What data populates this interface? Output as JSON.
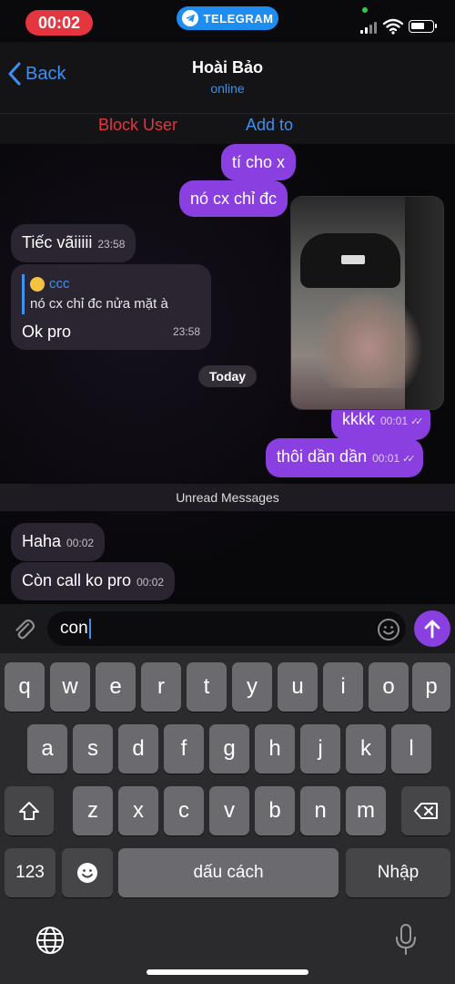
{
  "status_bar": {
    "time": "00:02",
    "app_pill": "TELEGRAM"
  },
  "header": {
    "back_label": "Back",
    "contact_name": "Hoài Bảo",
    "contact_status": "online",
    "block_user_label": "Block User",
    "add_contact_label": "Add to"
  },
  "messages": [
    {
      "direction": "out",
      "text": "tí cho x",
      "partially_hidden": true
    },
    {
      "direction": "out",
      "text": "nó cx chỉ đc",
      "partially_hidden": true
    },
    {
      "direction": "in",
      "text": "Tiếc vãiiiii",
      "time": "23:58"
    },
    {
      "direction": "in",
      "reply_author": "ccc",
      "reply_text": "nó cx chỉ đc nửa mặt à",
      "text": "Ok pro",
      "time": "23:58"
    },
    {
      "direction": "out",
      "text": "kkkk",
      "time": "00:01",
      "read": true
    },
    {
      "direction": "out",
      "text": "thôi dần dần",
      "time": "00:01",
      "read": true
    },
    {
      "direction": "in",
      "text": "Haha",
      "time": "00:02"
    },
    {
      "direction": "in",
      "text": "Còn call ko pro",
      "time": "00:02"
    }
  ],
  "day_separator": "Today",
  "unread_label": "Unread Messages",
  "composer": {
    "value": "con"
  },
  "keyboard": {
    "row1": [
      "q",
      "w",
      "e",
      "r",
      "t",
      "y",
      "u",
      "i",
      "o",
      "p"
    ],
    "row2": [
      "a",
      "s",
      "d",
      "f",
      "g",
      "h",
      "j",
      "k",
      "l"
    ],
    "row3": [
      "z",
      "x",
      "c",
      "v",
      "b",
      "n",
      "m"
    ],
    "numbers_key": "123",
    "space_key": "dấu cách",
    "return_key": "Nhập"
  },
  "colors": {
    "accent": "#3d91f0",
    "outgoing_bubble": "#8a3fe0",
    "incoming_bubble": "#2a2531",
    "danger": "#e5353f"
  }
}
